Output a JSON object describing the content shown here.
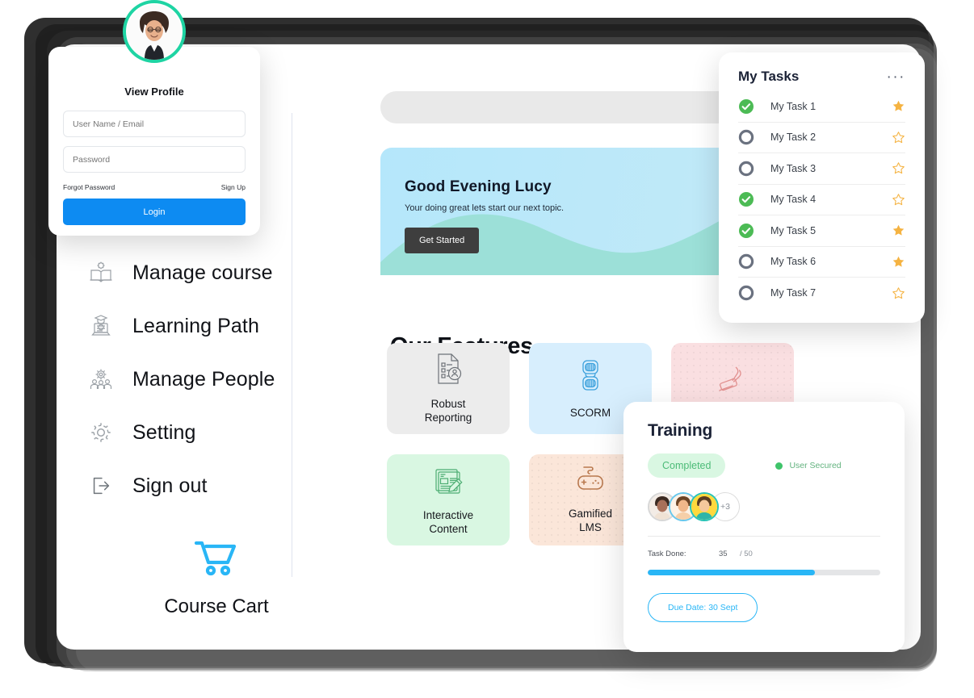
{
  "login": {
    "avatar_name": "user-avatar-photo",
    "ring_color": "#1ed4a3",
    "view_profile": "View Profile",
    "username_placeholder": "User Name / Email",
    "username_value": "",
    "password_placeholder": "Password",
    "password_value": "",
    "forgot": "Forgot Password",
    "signup": "Sign Up",
    "login_button": "Login",
    "login_color": "#0d8bf2"
  },
  "sidebar": {
    "items": [
      {
        "label": "Manage course",
        "icon": "book-gear-icon"
      },
      {
        "label": "Learning Path",
        "icon": "graduate-laptop-icon"
      },
      {
        "label": "Manage People",
        "icon": "people-gear-icon"
      },
      {
        "label": "Setting",
        "icon": "gear-icon"
      },
      {
        "label": "Sign out",
        "icon": "sign-out-icon"
      }
    ],
    "cart": {
      "label": "Course Cart",
      "icon": "shopping-cart-icon",
      "color": "#29b6f6"
    }
  },
  "search": {
    "value": "",
    "placeholder": "",
    "icon": "search-icon"
  },
  "banner": {
    "title": "Good Evening Lucy",
    "subtitle": "Your doing great lets start our next topic.",
    "button": "Get Started",
    "bg_color": "#b5e7fb",
    "wave_color": "#9ce0d8"
  },
  "features": {
    "heading": "Our Features",
    "cards": [
      {
        "label": "Robust\nReporting",
        "line1": "Robust",
        "line2": "Reporting",
        "bg": "#ececec",
        "icon": "report-document-icon",
        "icon_color": "#6d7278",
        "dots": false
      },
      {
        "label": "SCORM",
        "line1": "SCORM",
        "line2": "",
        "bg": "#d7eefd",
        "icon": "scorm-icon",
        "icon_color": "#3aa0dc",
        "dots": false
      },
      {
        "label": "",
        "line1": "",
        "line2": "",
        "bg": "#fadfe1",
        "icon": "stamp-icon",
        "icon_color": "#e79a9a",
        "dots": true
      },
      {
        "label": "Interactive\nContent",
        "line1": "Interactive",
        "line2": "Content",
        "bg": "#d9f7e2",
        "icon": "edit-document-icon",
        "icon_color": "#4cad72",
        "dots": false
      },
      {
        "label": "Gamified\nLMS",
        "line1": "Gamified",
        "line2": "LMS",
        "bg": "#fbe6d9",
        "icon": "gamepad-icon",
        "icon_color": "#b9794f",
        "dots": true
      },
      {
        "label": "",
        "line1": "",
        "line2": "",
        "bg": "#e2e1f5",
        "icon": "blank-icon",
        "icon_color": "#b9b7de",
        "dots": false
      }
    ]
  },
  "tasks": {
    "title": "My Tasks",
    "menu": "···",
    "check_color": "#4cbb55",
    "ring_color": "#6b7280",
    "star_color": "#f5b342",
    "items": [
      {
        "name": "My Task  1",
        "done": true,
        "starred": true
      },
      {
        "name": "My Task  2",
        "done": false,
        "starred": false
      },
      {
        "name": "My Task  3",
        "done": false,
        "starred": false
      },
      {
        "name": "My Task  4",
        "done": true,
        "starred": false
      },
      {
        "name": "My Task  5",
        "done": true,
        "starred": true
      },
      {
        "name": "My Task  6",
        "done": false,
        "starred": true
      },
      {
        "name": "My Task  7",
        "done": false,
        "starred": false
      }
    ]
  },
  "training": {
    "title": "Training",
    "status_pill": "Completed",
    "secured_label": "User Secured",
    "secured_color": "#3fc46a",
    "avatars_extra": "+3",
    "task_done_label": "Task Done:",
    "task_done_value": "35",
    "task_total": "/ 50",
    "progress_percent": 72,
    "progress_color": "#29b6f6",
    "due_button": "Due Date: 30 Sept",
    "due_color": "#29b6f6"
  }
}
